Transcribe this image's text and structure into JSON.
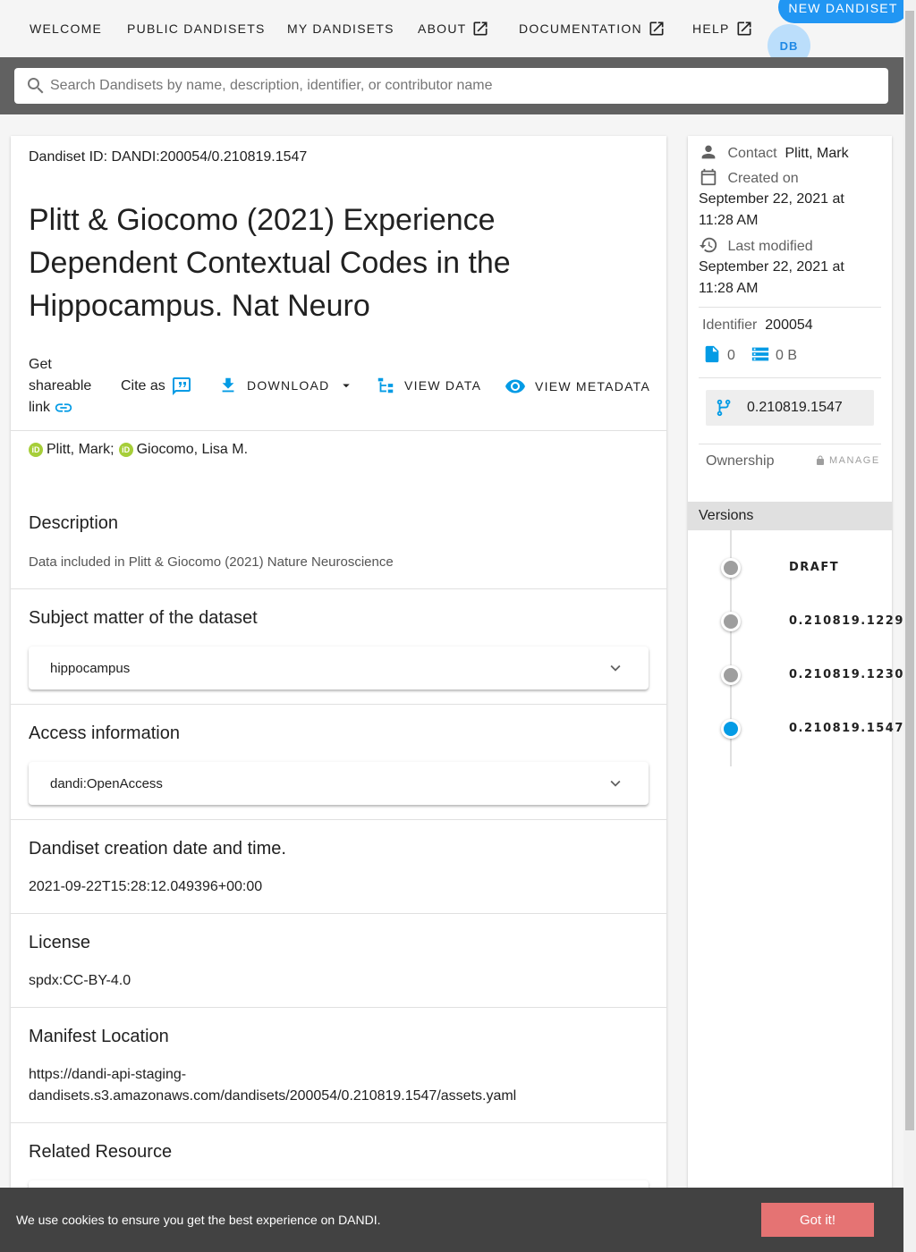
{
  "nav": {
    "items": [
      "WELCOME",
      "PUBLIC DANDISETS",
      "MY DANDISETS",
      "ABOUT",
      "DOCUMENTATION",
      "HELP"
    ],
    "new_dandiset": "NEW DANDISET",
    "avatar_initials": "DB"
  },
  "search": {
    "placeholder": "Search Dandisets by name, description, identifier, or contributor name"
  },
  "main": {
    "id_line": "Dandiset ID: DANDI:200054/0.210819.1547",
    "title": "Plitt & Giocomo (2021) Experience Dependent Contextual Codes in the Hippocampus. Nat Neuro",
    "share_label": "Get shareable link",
    "cite_label": "Cite as",
    "download_label": "DOWNLOAD",
    "view_data_label": "VIEW DATA",
    "view_metadata_label": "VIEW METADATA",
    "contributors": [
      "Plitt, Mark;",
      "Giocomo, Lisa M."
    ],
    "sections": {
      "description_title": "Description",
      "description_text": "Data included in Plitt & Giocomo (2021) Nature Neuroscience",
      "subject_title": "Subject matter of the dataset",
      "subject_value": "hippocampus",
      "access_title": "Access information",
      "access_value": "dandi:OpenAccess",
      "creation_title": "Dandiset creation date and time.",
      "creation_value": "2021-09-22T15:28:12.049396+00:00",
      "license_title": "License",
      "license_value": "spdx:CC-BY-4.0",
      "manifest_title": "Manifest Location",
      "manifest_value_1": "https://dandi-api-staging-",
      "manifest_value_2": "dandisets.s3.amazonaws.com/dandisets/200054/0.210819.1547/assets.yaml",
      "related_title": "Related Resource"
    }
  },
  "side": {
    "contact_label": "Contact",
    "contact_value": "Plitt, Mark",
    "created_label": "Created on",
    "created_value_1": "September 22, 2021 at",
    "created_value_2": "11:28 AM",
    "modified_label": "Last modified",
    "modified_value_1": "September 22, 2021 at",
    "modified_value_2": "11:28 AM",
    "identifier_label": "Identifier",
    "identifier_value": "200054",
    "file_count": "0",
    "size": "0 B",
    "current_version": "0.210819.1547",
    "ownership_label": "Ownership",
    "manage_label": "MANAGE",
    "versions_title": "Versions",
    "versions": [
      {
        "label": "DRAFT",
        "color": "#9e9e9e"
      },
      {
        "label": "0.210819.1229",
        "color": "#9e9e9e"
      },
      {
        "label": "0.210819.1230",
        "color": "#9e9e9e"
      },
      {
        "label": "0.210819.1547",
        "color": "#039be5"
      }
    ]
  },
  "cookie": {
    "text": "We use cookies to ensure you get the best experience on DANDI.",
    "button": "Got it!"
  },
  "colors": {
    "accent": "#2196f3",
    "icon_blue": "#039be5",
    "cookie_button": "#e57373"
  }
}
